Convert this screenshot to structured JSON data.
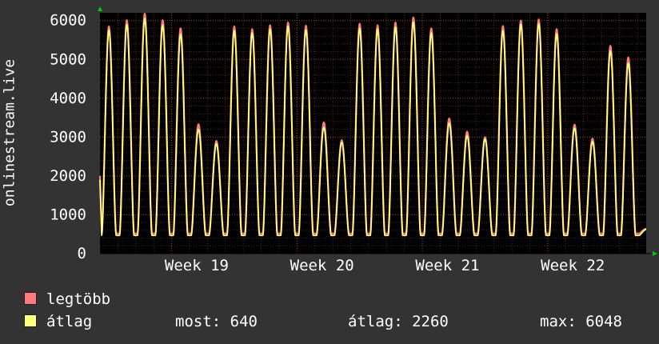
{
  "chart_data": {
    "type": "line",
    "title": "",
    "ylabel": "onlinestream.live",
    "xlabel": "",
    "ylim": [
      0,
      6200
    ],
    "yticks": [
      0,
      1000,
      2000,
      3000,
      4000,
      5000,
      6000
    ],
    "xticks": [
      "Week 19",
      "Week 20",
      "Week 21",
      "Week 22"
    ],
    "grid": true,
    "days_shown": 30.5,
    "daily_peaks": [
      5850,
      6010,
      6180,
      6010,
      5800,
      3330,
      2900,
      5850,
      5780,
      5880,
      5950,
      5870,
      3380,
      2920,
      5920,
      5880,
      5950,
      6080,
      5800,
      3480,
      3140,
      3000,
      5860,
      6000,
      6030,
      5780,
      3320,
      2960,
      5350,
      5050,
      640
    ],
    "daily_avg_peaks": [
      5750,
      5900,
      6050,
      5880,
      5650,
      3200,
      2830,
      5740,
      5680,
      5780,
      5850,
      5760,
      3250,
      2860,
      5800,
      5780,
      5830,
      5960,
      5680,
      3360,
      3040,
      2950,
      5740,
      5900,
      5920,
      5660,
      3230,
      2880,
      5220,
      4900,
      620
    ],
    "series": [
      {
        "name": "legtöbb",
        "color": "#ff7a7a"
      },
      {
        "name": "átlag",
        "color": "#ffff80"
      }
    ]
  },
  "legend": {
    "max_label": "legtöbb",
    "avg_label": "átlag",
    "now_text": "most: 640",
    "avg_text": "átlag: 2260",
    "max_text": "max: 6048"
  }
}
